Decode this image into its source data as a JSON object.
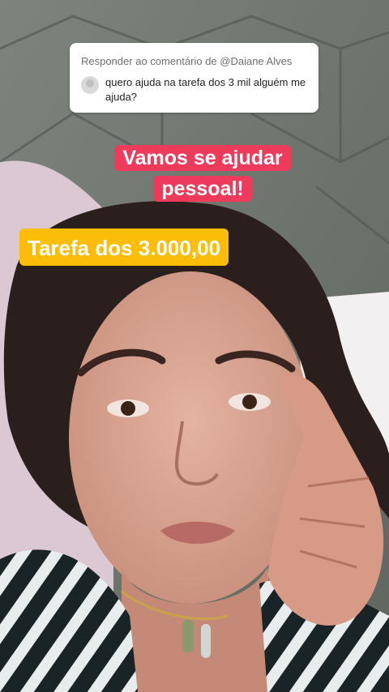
{
  "reply_card": {
    "header": "Responder ao comentário de @Daiane Alves",
    "comment": "quero ajuda na tarefa dos 3 mil alguém me ajuda?"
  },
  "captions": {
    "red": "Vamos se ajudar pessoal!",
    "yellow": "Tarefa dos 3.000,00"
  },
  "colors": {
    "red_caption": "#ee3b5b",
    "yellow_caption": "#fbbd08",
    "headboard": "#6f7670",
    "pillow": "#dcc8d2"
  }
}
